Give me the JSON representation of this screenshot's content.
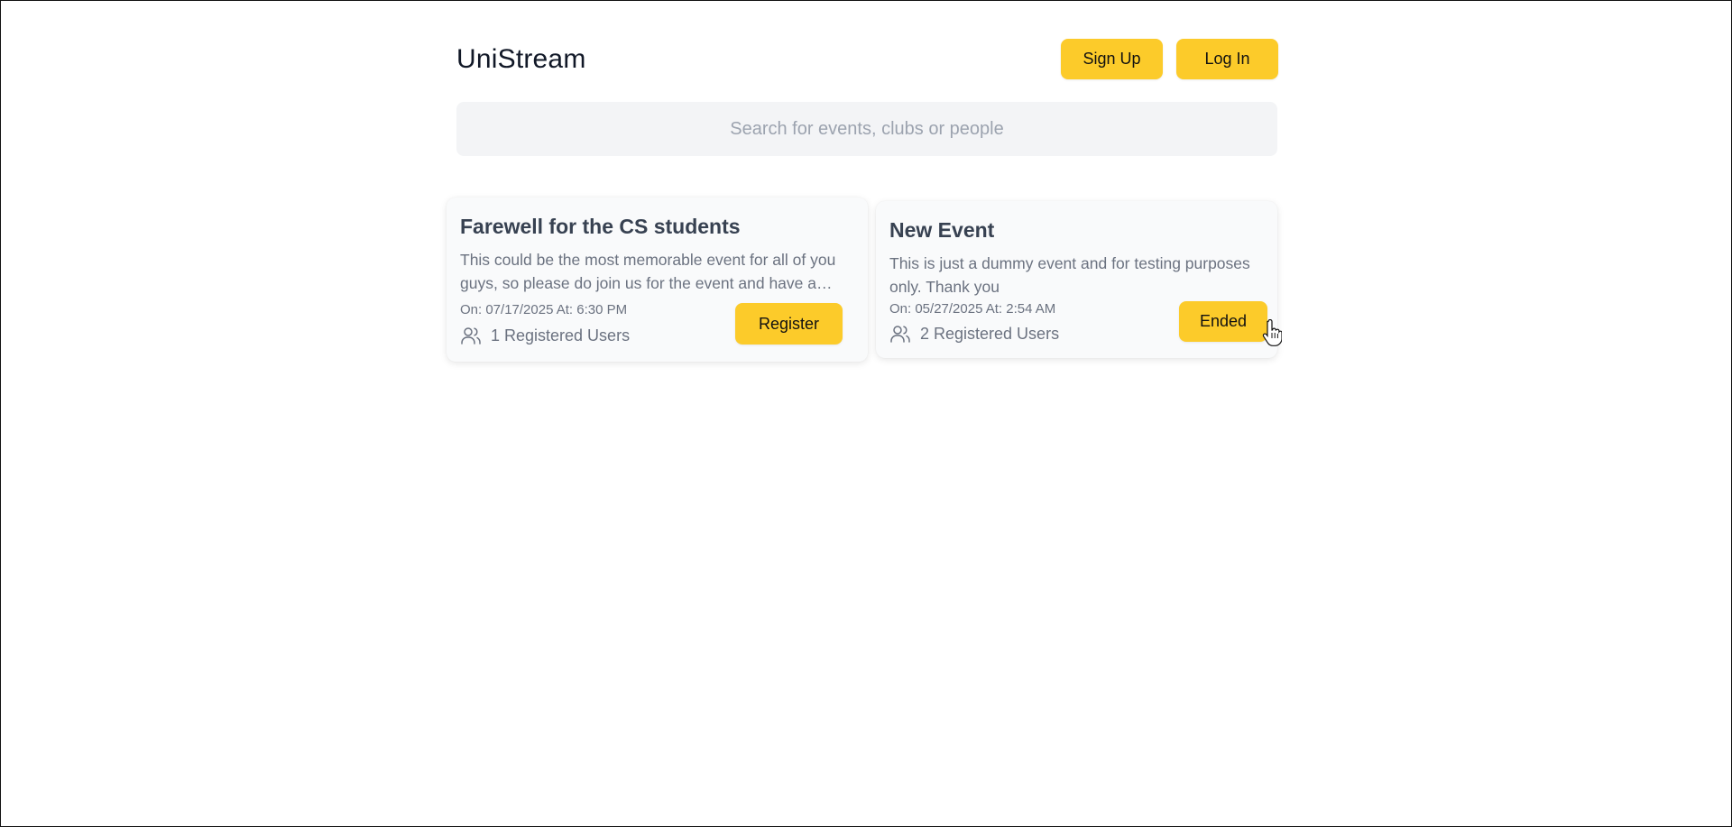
{
  "app": {
    "brand": "UniStream"
  },
  "header": {
    "signup_label": "Sign Up",
    "login_label": "Log In"
  },
  "search": {
    "placeholder": "Search for events, clubs or people"
  },
  "events": [
    {
      "title": "Farewell for the CS students",
      "description": "This could be the most memorable event for all of you guys, so please do join us for the event and have a great time together.",
      "date": "On: 07/17/2025 At: 6:30 PM",
      "registered": "1 Registered Users",
      "action_label": "Register"
    },
    {
      "title": "New Event",
      "description": "This is just a dummy event and for testing purposes only. Thank you",
      "date": "On: 05/27/2025 At: 2:54 AM",
      "registered": "2 Registered Users",
      "action_label": "Ended"
    }
  ],
  "colors": {
    "accent": "#fccb2a",
    "search_bg": "#f3f4f6",
    "card_bg": "#f9fafb",
    "muted_text": "#6b7280"
  },
  "icons": {
    "users": "users-icon",
    "cursor": "hand-pointer-cursor"
  }
}
